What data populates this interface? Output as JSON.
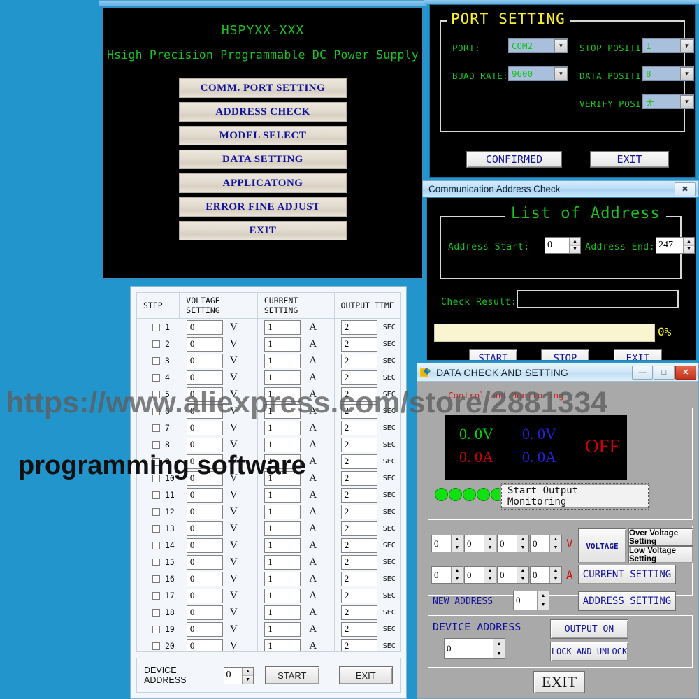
{
  "background_color": "#2295cc",
  "main_menu": {
    "title": "HSPYXX-XXX",
    "subtitle": "Hsigh Precision Programmable DC Power Supply",
    "title_color": "#18c21f",
    "buttons": [
      "COMM. PORT SETTING",
      "ADDRESS CHECK",
      "MODEL   SELECT",
      "DATA   SETTING",
      "APPLICATONG",
      "ERROR FINE ADJUST",
      "EXIT"
    ]
  },
  "port_setting": {
    "legend": "PORT SETTING",
    "legend_color": "#f6f02c",
    "fields": [
      {
        "label": "PORT:",
        "value": "COM2"
      },
      {
        "label": "STOP POSITION:",
        "value": "1"
      },
      {
        "label": "BUAD RATE:",
        "value": "9600"
      },
      {
        "label": "DATA POSITION:",
        "value": "8"
      },
      {
        "label": "VERIFY POSITION:",
        "value": "无"
      }
    ],
    "confirm_label": "CONFIRMED",
    "exit_label": "EXIT"
  },
  "address_check": {
    "window_title": "Communication Address Check",
    "close_glyph": "✖",
    "legend": "List of Address",
    "start_label": "Address Start:",
    "start_value": "0",
    "end_label": "Address End:",
    "end_value": "247",
    "result_label": "Check Result:",
    "result_value": "",
    "progress_percent": "0%",
    "progress_value": 0,
    "buttons": [
      "START",
      "STOP",
      "EXIT"
    ]
  },
  "step_table": {
    "columns": [
      "STEP",
      "VOLTAGE SETTING",
      "CURRENT SETTING",
      "OUTPUT TIME"
    ],
    "units": {
      "voltage": "V",
      "current": "A",
      "time": "SEC"
    },
    "rows": [
      {
        "step": "1",
        "voltage": "0",
        "current": "1",
        "time": "2",
        "checked": false
      },
      {
        "step": "2",
        "voltage": "0",
        "current": "1",
        "time": "2",
        "checked": false
      },
      {
        "step": "3",
        "voltage": "0",
        "current": "1",
        "time": "2",
        "checked": false
      },
      {
        "step": "4",
        "voltage": "0",
        "current": "1",
        "time": "2",
        "checked": false
      },
      {
        "step": "5",
        "voltage": "0",
        "current": "1",
        "time": "2",
        "checked": false
      },
      {
        "step": "6",
        "voltage": "0",
        "current": "1",
        "time": "2",
        "checked": false
      },
      {
        "step": "7",
        "voltage": "0",
        "current": "1",
        "time": "2",
        "checked": false
      },
      {
        "step": "8",
        "voltage": "0",
        "current": "1",
        "time": "2",
        "checked": false
      },
      {
        "step": "9",
        "voltage": "0",
        "current": "1",
        "time": "2",
        "checked": false
      },
      {
        "step": "10",
        "voltage": "0",
        "current": "1",
        "time": "2",
        "checked": false
      },
      {
        "step": "11",
        "voltage": "0",
        "current": "1",
        "time": "2",
        "checked": false
      },
      {
        "step": "12",
        "voltage": "0",
        "current": "1",
        "time": "2",
        "checked": false
      },
      {
        "step": "13",
        "voltage": "0",
        "current": "1",
        "time": "2",
        "checked": false
      },
      {
        "step": "14",
        "voltage": "0",
        "current": "1",
        "time": "2",
        "checked": false
      },
      {
        "step": "15",
        "voltage": "0",
        "current": "1",
        "time": "2",
        "checked": false
      },
      {
        "step": "16",
        "voltage": "0",
        "current": "1",
        "time": "2",
        "checked": false
      },
      {
        "step": "17",
        "voltage": "0",
        "current": "1",
        "time": "2",
        "checked": false
      },
      {
        "step": "18",
        "voltage": "0",
        "current": "1",
        "time": "2",
        "checked": false
      },
      {
        "step": "19",
        "voltage": "0",
        "current": "1",
        "time": "2",
        "checked": false
      },
      {
        "step": "20",
        "voltage": "0",
        "current": "1",
        "time": "2",
        "checked": false
      }
    ],
    "footer": {
      "device_address_label": "DEVICE ADDRESS",
      "device_address_value": "0",
      "start_label": "START",
      "exit_label": "EXIT"
    }
  },
  "data_check": {
    "window_title": "DATA CHECK AND SETTING",
    "titlebar_buttons": {
      "minimize": "—",
      "maximize": "□",
      "close": "✕"
    },
    "group_label": "Control and Monitoring",
    "group_label_color": "#d11a1a",
    "display": {
      "set_voltage": "0. 0V",
      "set_voltage_color": "#00d200",
      "read_voltage": "0. 0V",
      "read_voltage_color": "#2222dd",
      "set_current": "0. 0A",
      "set_current_color": "#cc0000",
      "read_current": "0. 0A",
      "read_current_color": "#2222dd",
      "output_state": "OFF",
      "output_state_color": "#cc0000"
    },
    "led_count": 5,
    "led_color": "#11e011",
    "monitor_button": "Start Output Monitoring",
    "voltage_digits": [
      "0",
      "0",
      "0",
      "0"
    ],
    "voltage_unit": "V",
    "voltage_button": "VOLTAGE",
    "over_voltage_button": "Over Voltage Setting",
    "low_voltage_button": "Low Voltage Setting",
    "current_digits": [
      "0",
      "0",
      "0",
      "0"
    ],
    "current_unit": "A",
    "current_button": "CURRENT SETTING",
    "new_address_label": "NEW ADDRESS",
    "new_address_value": "0",
    "address_setting_button": "ADDRESS SETTING",
    "device_address_label": "DEVICE ADDRESS",
    "device_address_value": "0",
    "output_on_button": "OUTPUT ON",
    "lock_unlock_button": "LOCK AND UNLOCK",
    "exit_button": "EXIT"
  },
  "watermark": {
    "url": "https://www.aliexpress.com/store/2881334",
    "text": "programming software"
  }
}
